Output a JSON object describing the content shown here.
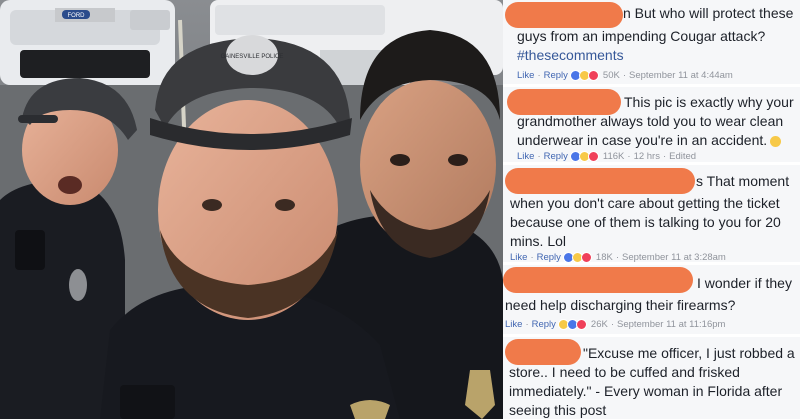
{
  "comments": [
    {
      "text_line1": "n But who will protect these",
      "text_line2": "guys from an impending Cougar attack?",
      "hashtag": "#thesecomments",
      "like": "Like",
      "reply": "Reply",
      "count": "50K",
      "time": "September 11 at 4:44am"
    },
    {
      "text_line1": "This pic is exactly why your",
      "text_line2": "grandmother always told you to wear clean",
      "text_line3": "underwear in case you're in an accident.",
      "like": "Like",
      "reply": "Reply",
      "count": "116K",
      "time": "12 hrs",
      "edited": "Edited"
    },
    {
      "text_line1": "s That moment",
      "text_line2": "when you don't care about getting the ticket",
      "text_line3": "because one of them is talking to you for 20",
      "text_line4": "mins. Lol",
      "like": "Like",
      "reply": "Reply",
      "count": "18K",
      "time": "September 11 at 3:28am"
    },
    {
      "text_line1": "I wonder if they",
      "text_line2": "need help discharging their firearms?",
      "like": "Like",
      "reply": "Reply",
      "count": "26K",
      "time": "September 11 at 11:16pm"
    },
    {
      "text_line1": "\"Excuse me officer, I just robbed a",
      "text_line2": "store.. I need to be cuffed and frisked",
      "text_line3": "immediately.\" - Every woman in Florida after",
      "text_line4": "seeing this post"
    }
  ],
  "photo": {
    "car_badge": "FORD",
    "cap_badge": "GAINESVILLE POLICE"
  },
  "colors": {
    "redaction": "#f07a4a",
    "link": "#4267b2",
    "panel_bg": "#f6f7f9"
  }
}
